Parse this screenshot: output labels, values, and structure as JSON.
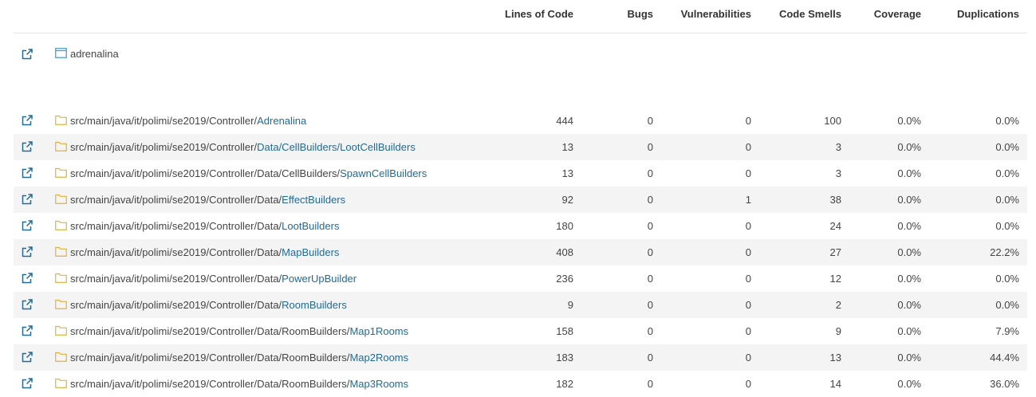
{
  "colors": {
    "link": "#236a97",
    "folder": "#e3b23c",
    "project": "#4b9fd5",
    "stripe": "#f4f4f4"
  },
  "headers": {
    "lines_of_code": "Lines of Code",
    "bugs": "Bugs",
    "vulnerabilities": "Vulnerabilities",
    "code_smells": "Code Smells",
    "coverage": "Coverage",
    "duplications": "Duplications"
  },
  "root": {
    "icon": "open-in-new-icon",
    "project_icon": "project-icon",
    "name": "adrenalina"
  },
  "rows": [
    {
      "prefix": "src/main/java/it/polimi/se2019/Controller/",
      "link": "Adrenalina",
      "loc": "444",
      "bugs": "0",
      "vulnerabilities": "0",
      "code_smells": "100",
      "coverage": "0.0%",
      "duplications": "0.0%"
    },
    {
      "prefix": "src/main/java/it/polimi/se2019/Controller/",
      "link": "Data/CellBuilders/LootCellBuilders",
      "loc": "13",
      "bugs": "0",
      "vulnerabilities": "0",
      "code_smells": "3",
      "coverage": "0.0%",
      "duplications": "0.0%"
    },
    {
      "prefix": "src/main/java/it/polimi/se2019/Controller/Data/CellBuilders/",
      "link": "SpawnCellBuilders",
      "loc": "13",
      "bugs": "0",
      "vulnerabilities": "0",
      "code_smells": "3",
      "coverage": "0.0%",
      "duplications": "0.0%"
    },
    {
      "prefix": "src/main/java/it/polimi/se2019/Controller/Data/",
      "link": "EffectBuilders",
      "loc": "92",
      "bugs": "0",
      "vulnerabilities": "1",
      "code_smells": "38",
      "coverage": "0.0%",
      "duplications": "0.0%"
    },
    {
      "prefix": "src/main/java/it/polimi/se2019/Controller/Data/",
      "link": "LootBuilders",
      "loc": "180",
      "bugs": "0",
      "vulnerabilities": "0",
      "code_smells": "24",
      "coverage": "0.0%",
      "duplications": "0.0%"
    },
    {
      "prefix": "src/main/java/it/polimi/se2019/Controller/Data/",
      "link": "MapBuilders",
      "loc": "408",
      "bugs": "0",
      "vulnerabilities": "0",
      "code_smells": "27",
      "coverage": "0.0%",
      "duplications": "22.2%"
    },
    {
      "prefix": "src/main/java/it/polimi/se2019/Controller/Data/",
      "link": "PowerUpBuilder",
      "loc": "236",
      "bugs": "0",
      "vulnerabilities": "0",
      "code_smells": "12",
      "coverage": "0.0%",
      "duplications": "0.0%"
    },
    {
      "prefix": "src/main/java/it/polimi/se2019/Controller/Data/",
      "link": "RoomBuilders",
      "loc": "9",
      "bugs": "0",
      "vulnerabilities": "0",
      "code_smells": "2",
      "coverage": "0.0%",
      "duplications": "0.0%"
    },
    {
      "prefix": "src/main/java/it/polimi/se2019/Controller/Data/RoomBuilders/",
      "link": "Map1Rooms",
      "loc": "158",
      "bugs": "0",
      "vulnerabilities": "0",
      "code_smells": "9",
      "coverage": "0.0%",
      "duplications": "7.9%"
    },
    {
      "prefix": "src/main/java/it/polimi/se2019/Controller/Data/RoomBuilders/",
      "link": "Map2Rooms",
      "loc": "183",
      "bugs": "0",
      "vulnerabilities": "0",
      "code_smells": "13",
      "coverage": "0.0%",
      "duplications": "44.4%"
    },
    {
      "prefix": "src/main/java/it/polimi/se2019/Controller/Data/RoomBuilders/",
      "link": "Map3Rooms",
      "loc": "182",
      "bugs": "0",
      "vulnerabilities": "0",
      "code_smells": "14",
      "coverage": "0.0%",
      "duplications": "36.0%"
    }
  ]
}
